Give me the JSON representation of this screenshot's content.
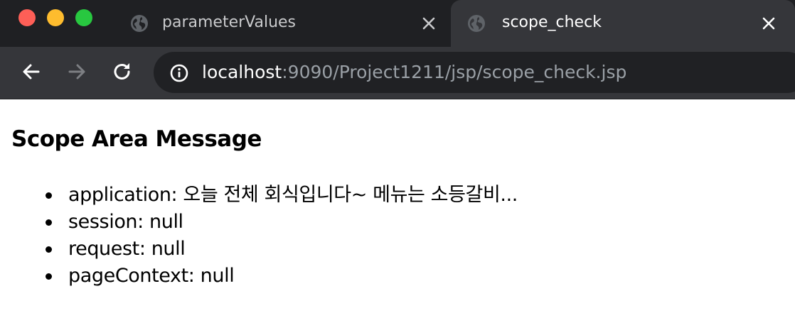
{
  "window": {
    "controls": [
      "close",
      "minimize",
      "maximize"
    ]
  },
  "tabs": [
    {
      "title": "parameterValues",
      "active": false,
      "icon": "globe-icon"
    },
    {
      "title": "scope_check",
      "active": true,
      "icon": "globe-icon"
    }
  ],
  "toolbar": {
    "back_icon": "back-arrow-icon",
    "forward_icon": "forward-arrow-icon",
    "reload_icon": "reload-icon",
    "url_host": "localhost",
    "url_rest": ":9090/Project1211/jsp/scope_check.jsp",
    "info_icon": "info-icon"
  },
  "page": {
    "heading": "Scope Area Message",
    "items": [
      "application: 오늘 전체 회식입니다~ 메뉴는 소등갈비...",
      "session: null",
      "request: null",
      "pageContext: null"
    ]
  },
  "colors": {
    "tabstrip": "#1f2023",
    "active_tab": "#35363a",
    "omnibox": "#202124",
    "close_dot": "#fe5f57",
    "minimize_dot": "#febc2e",
    "maximize_dot": "#28c840"
  }
}
